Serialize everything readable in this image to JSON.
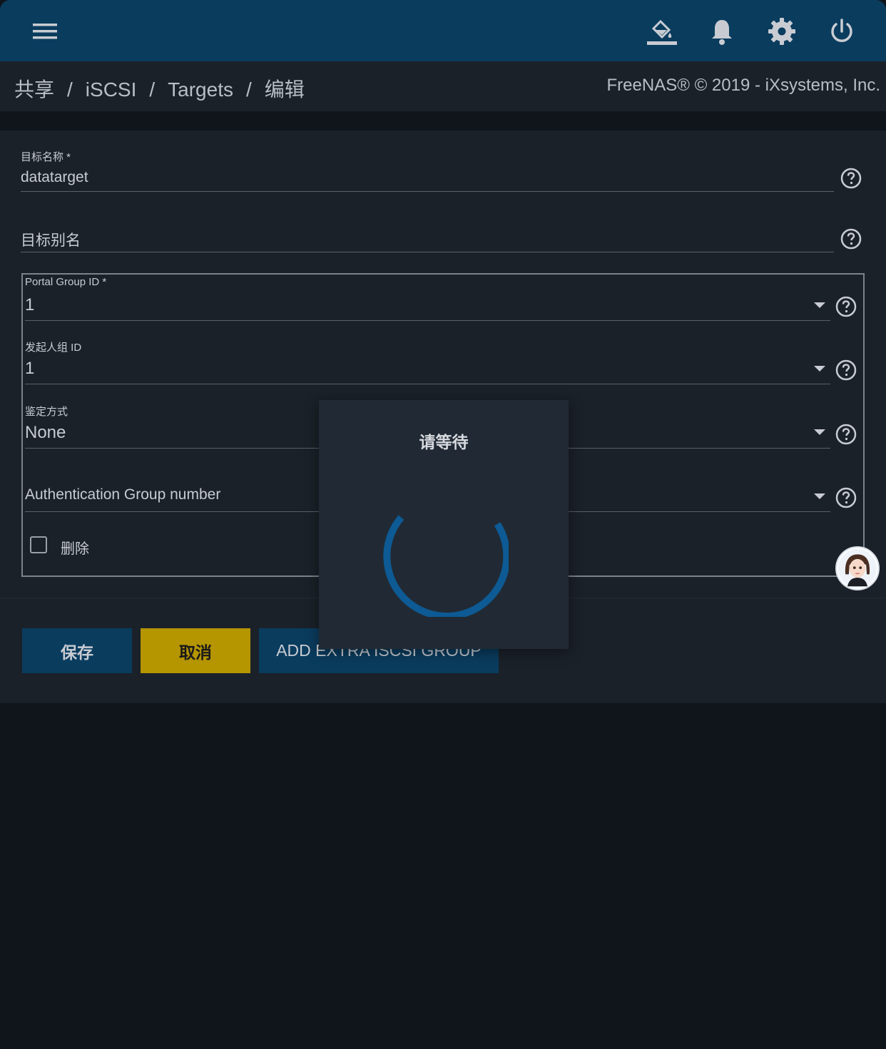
{
  "topbar": {
    "icons": [
      "menu-icon",
      "paint-bucket-icon",
      "bell-icon",
      "gear-icon",
      "power-icon"
    ],
    "color": "#0a3c5e"
  },
  "breadcrumb": {
    "items": [
      "共享",
      "iSCSI",
      "Targets",
      "编辑"
    ],
    "separator": "/"
  },
  "copyright": "FreeNAS® © 2019 - iXsystems, Inc.",
  "form": {
    "target_name": {
      "label": "目标名称 *",
      "value": "datatarget"
    },
    "target_alias": {
      "placeholder": "目标别名",
      "value": ""
    },
    "group": {
      "portal_group_id": {
        "label": "Portal Group ID *",
        "value": "1"
      },
      "initiator_group_id": {
        "label": "发起人组 ID",
        "value": "1"
      },
      "auth_method": {
        "label": "鉴定方式",
        "value": "None"
      },
      "auth_group_number": {
        "placeholder": "Authentication Group number",
        "value": ""
      },
      "delete_label": "删除"
    }
  },
  "buttons": {
    "save": "保存",
    "cancel": "取消",
    "add_extra": "ADD EXTRA ISCSI GROUP"
  },
  "dialog": {
    "title": "请等待"
  },
  "colors": {
    "accent": "#0a3c5e",
    "cancel": "#b59500",
    "spinner": "#0d5a94",
    "background": "#10141b",
    "card": "#1b2129"
  }
}
